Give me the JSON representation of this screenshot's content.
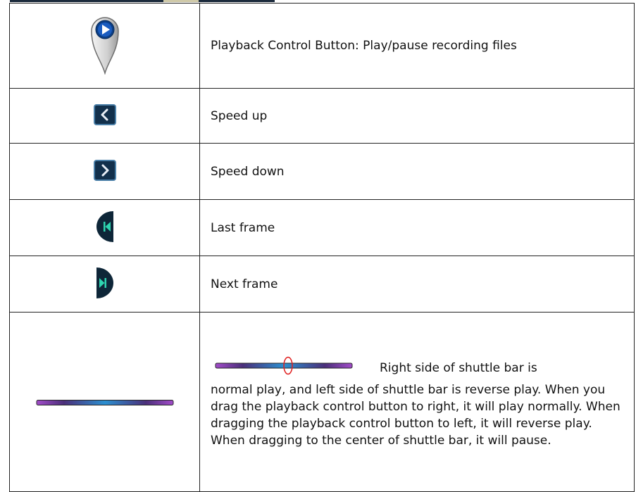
{
  "rows": [
    {
      "icon": "play-pin-icon",
      "text": "Playback Control Button: Play/pause recording files"
    },
    {
      "icon": "chevron-left-icon",
      "text": "Speed up"
    },
    {
      "icon": "chevron-right-icon",
      "text": "Speed down"
    },
    {
      "icon": "skip-back-icon",
      "text": "Last frame"
    },
    {
      "icon": "skip-forward-icon",
      "text": "Next frame"
    }
  ],
  "shuttle": {
    "icon": "shuttle-bar-icon",
    "first_line": "Right side of shuttle bar is",
    "rest": "normal play, and left side of shuttle bar is reverse play. When you drag the playback control button to right, it will play normally. When dragging the playback control button to left, it will reverse play. When dragging to the center of shuttle bar, it will pause."
  },
  "colors": {
    "button_dark": "#0f2740",
    "button_accent": "#3aa0d8",
    "bar_left": "#a24cc9",
    "bar_middle": "#2b8fd0",
    "marker": "#e02020"
  }
}
